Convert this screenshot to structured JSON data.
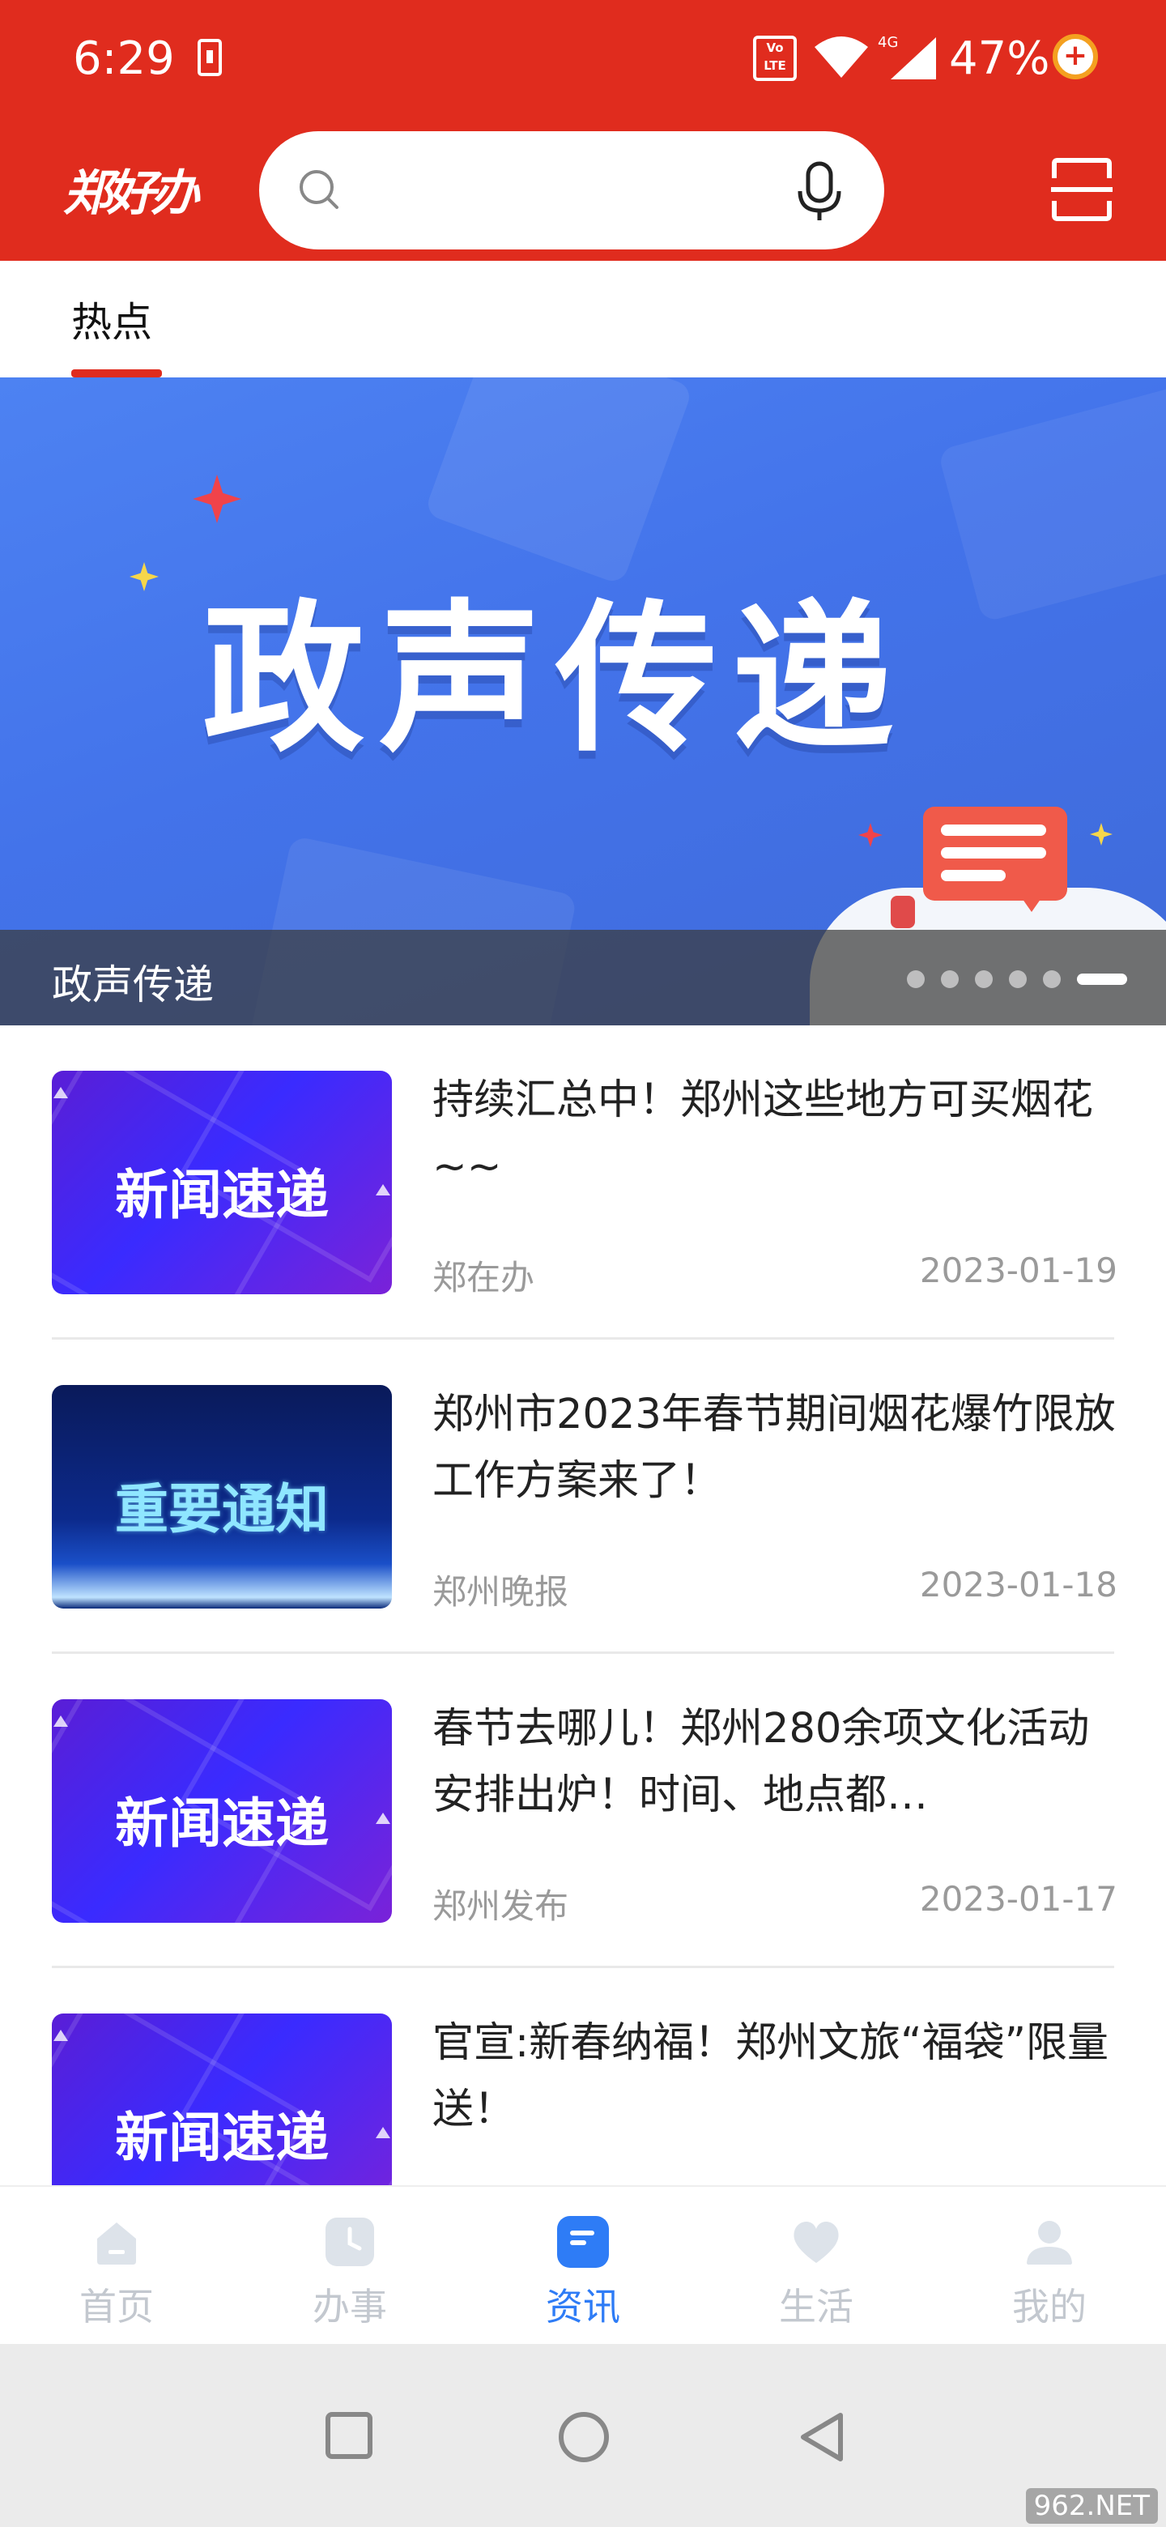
{
  "status_bar": {
    "time": "6:29",
    "volte": "Vo LTE",
    "network": "4G",
    "battery": "47%"
  },
  "header": {
    "logo": "郑好办",
    "search_placeholder": ""
  },
  "tabs": [
    {
      "label": "热点",
      "active": true
    }
  ],
  "banner": {
    "headline": "政声传递",
    "caption": "政声传递",
    "slide_count": 6,
    "active_slide": 6
  },
  "news": [
    {
      "title": "持续汇总中！郑州这些地方可买烟花~~",
      "source": "郑在办",
      "date": "2023-01-19",
      "thumb_label": "新闻速递",
      "thumb_style": "news"
    },
    {
      "title": "郑州市2023年春节期间烟花爆竹限放工作方案来了！",
      "source": "郑州晚报",
      "date": "2023-01-18",
      "thumb_label": "重要通知",
      "thumb_style": "notice"
    },
    {
      "title": "春节去哪儿！郑州280余项文化活动安排出炉！时间、地点都…",
      "source": "郑州发布",
      "date": "2023-01-17",
      "thumb_label": "新闻速递",
      "thumb_style": "news"
    },
    {
      "title": "官宣:新春纳福！郑州文旅“福袋”限量送！",
      "source": "",
      "date": "",
      "thumb_label": "新闻速递",
      "thumb_style": "news"
    }
  ],
  "bottom_nav": [
    {
      "label": "首页",
      "icon": "home-icon",
      "active": false
    },
    {
      "label": "办事",
      "icon": "clock-icon",
      "active": false
    },
    {
      "label": "资讯",
      "icon": "news-icon",
      "active": true
    },
    {
      "label": "生活",
      "icon": "heart-icon",
      "active": false
    },
    {
      "label": "我的",
      "icon": "user-icon",
      "active": false
    }
  ],
  "watermark": "962.NET",
  "colors": {
    "brand_red": "#e02c1e",
    "active_blue": "#2e7cf6",
    "banner_blue": "#4373ea"
  }
}
